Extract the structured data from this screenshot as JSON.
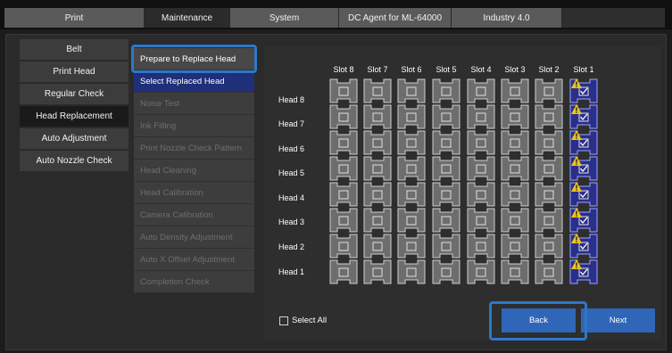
{
  "tabs": [
    {
      "label": "Print",
      "active": false
    },
    {
      "label": "Maintenance",
      "active": true
    },
    {
      "label": "System",
      "active": false
    },
    {
      "label": "DC Agent for ML-64000",
      "active": false
    },
    {
      "label": "Industry 4.0",
      "active": false
    }
  ],
  "left_menu": [
    {
      "label": "Belt",
      "active": false
    },
    {
      "label": "Print Head",
      "active": false
    },
    {
      "label": "Regular Check",
      "active": false
    },
    {
      "label": "Head Replacement",
      "active": true
    },
    {
      "label": "Auto Adjustment",
      "active": false
    },
    {
      "label": "Auto Nozzle Check",
      "active": false
    }
  ],
  "steps": [
    {
      "label": "Prepare to Replace Head",
      "state": "done"
    },
    {
      "label": "Select Replaced Head",
      "state": "current"
    },
    {
      "label": "Noise Test",
      "state": "pending"
    },
    {
      "label": "Ink Filling",
      "state": "pending"
    },
    {
      "label": "Print Nozzle Check Pattern",
      "state": "pending"
    },
    {
      "label": "Head Cleaning",
      "state": "pending"
    },
    {
      "label": "Head Calibration",
      "state": "pending"
    },
    {
      "label": "Camera Calibration",
      "state": "pending"
    },
    {
      "label": "Auto Density Adjustment",
      "state": "pending"
    },
    {
      "label": "Auto X Offset Adjustment",
      "state": "pending"
    },
    {
      "label": "Completion Check",
      "state": "pending"
    }
  ],
  "grid": {
    "slots": [
      "Slot 8",
      "Slot 7",
      "Slot 6",
      "Slot 5",
      "Slot 4",
      "Slot 3",
      "Slot 2",
      "Slot 1"
    ],
    "heads": [
      "Head 8",
      "Head 7",
      "Head 6",
      "Head 5",
      "Head 4",
      "Head 3",
      "Head 2",
      "Head 1"
    ],
    "selected_slots": [
      "Slot 1"
    ]
  },
  "select_all_label": "Select All",
  "buttons": {
    "back": "Back",
    "next": "Next"
  },
  "colors": {
    "accent": "#2f66b8",
    "current_step": "#1f2f78",
    "selected_slot": "#2a2f8a",
    "warning": "#f0c419"
  }
}
